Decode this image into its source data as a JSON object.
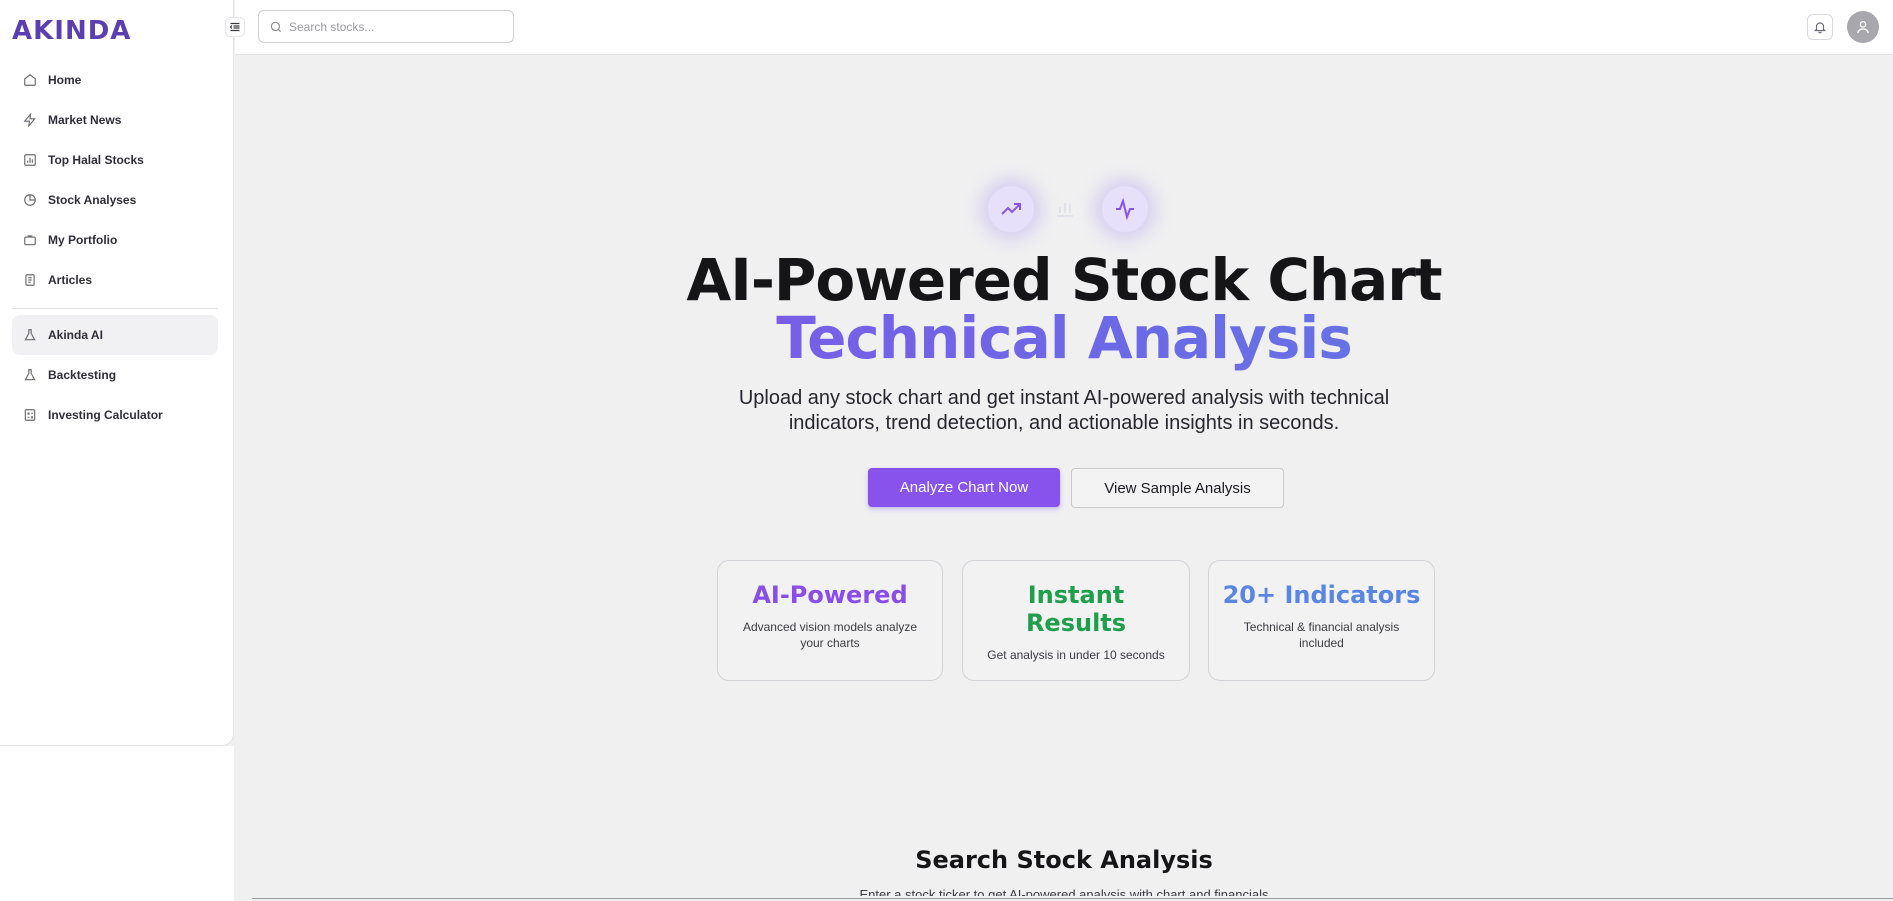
{
  "app": {
    "logo_text": "AKINDA"
  },
  "header": {
    "search_placeholder": "Search stocks...",
    "bell_icon": "bell-icon",
    "avatar_icon": "user-icon"
  },
  "sidebar": {
    "items": [
      {
        "label": "Home",
        "icon": "home-icon"
      },
      {
        "label": "Market News",
        "icon": "lightning-icon"
      },
      {
        "label": "Top Halal Stocks",
        "icon": "bar-chart-icon"
      },
      {
        "label": "Stock Analyses",
        "icon": "pie-chart-icon"
      },
      {
        "label": "My Portfolio",
        "icon": "briefcase-icon"
      },
      {
        "label": "Articles",
        "icon": "document-icon"
      }
    ],
    "tools": [
      {
        "label": "Akinda AI",
        "icon": "flask-icon",
        "active": true
      },
      {
        "label": "Backtesting",
        "icon": "flask-icon"
      },
      {
        "label": "Investing Calculator",
        "icon": "calculator-icon"
      }
    ]
  },
  "hero": {
    "title_line1": "AI-Powered Stock Chart",
    "title_line2": "Technical Analysis",
    "subtitle": "Upload any stock chart and get instant AI-powered analysis with technical indicators, trend detection, and actionable insights in seconds.",
    "primary_button": "Analyze Chart Now",
    "secondary_button": "View Sample Analysis",
    "icons": [
      "trending-up-icon",
      "bar-chart-icon",
      "activity-icon"
    ],
    "accent_color": "#8753ec"
  },
  "features": [
    {
      "title": "AI-Powered",
      "desc": "Advanced vision models analyze your charts",
      "color": "#8a4ee8"
    },
    {
      "title": "Instant Results",
      "desc": "Get analysis in under 10 seconds",
      "color": "#1f9e4c"
    },
    {
      "title": "20+ Indicators",
      "desc": "Technical & financial analysis included",
      "color": "#5a86e2"
    }
  ],
  "search_section": {
    "title": "Search Stock Analysis",
    "subtitle": "Enter a stock ticker to get AI-powered analysis with chart and financials"
  }
}
